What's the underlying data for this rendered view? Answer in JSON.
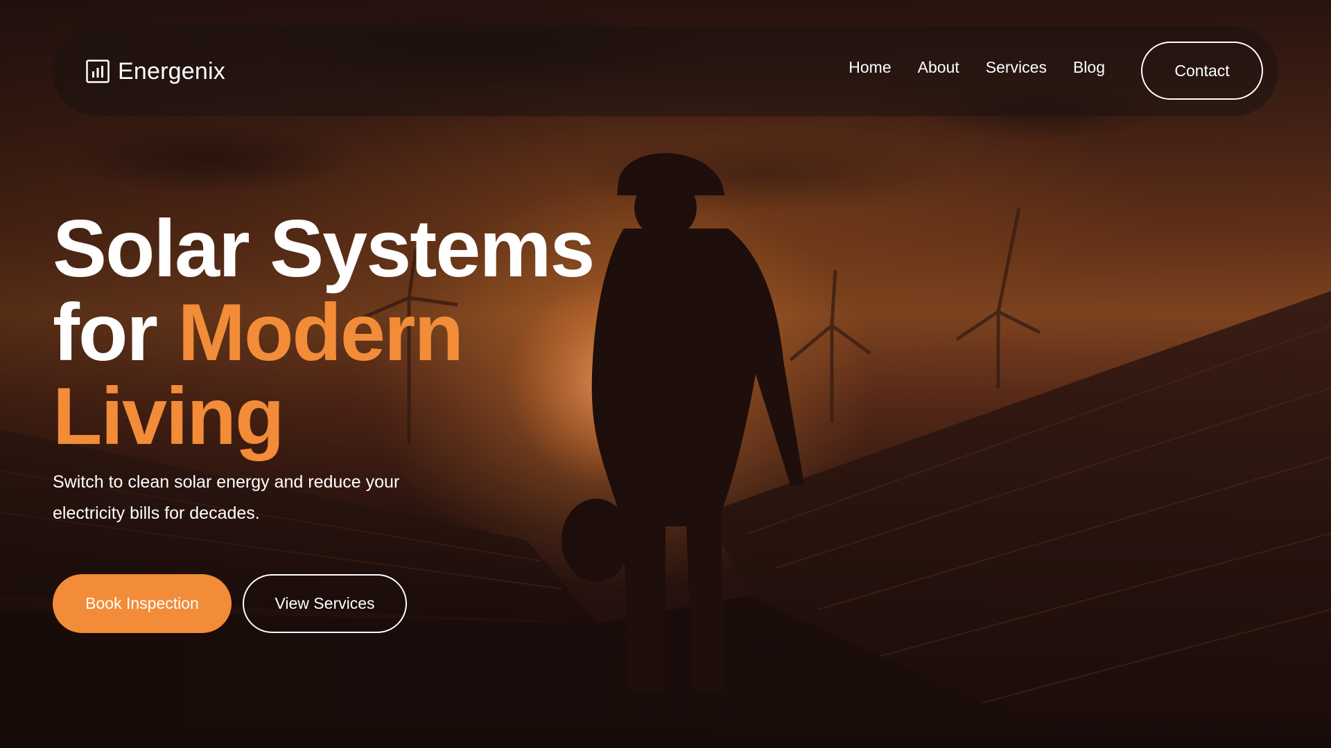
{
  "brand": {
    "name": "Energenix",
    "icon": "bar-chart-icon"
  },
  "nav": {
    "items": [
      {
        "label": "Home"
      },
      {
        "label": "About"
      },
      {
        "label": "Services"
      },
      {
        "label": "Blog"
      }
    ],
    "contact_label": "Contact"
  },
  "hero": {
    "headline_line1": "Solar Systems",
    "headline_for": "for",
    "headline_accent_1": "Modern",
    "headline_accent_2": "Living",
    "subtitle": "Switch to clean solar energy and reduce your electricity bills for decades.",
    "primary_button": "Book Inspection",
    "secondary_button": "View Services"
  },
  "colors": {
    "accent": "#f28c38",
    "text": "#ffffff",
    "nav_bg": "#1c1210"
  }
}
